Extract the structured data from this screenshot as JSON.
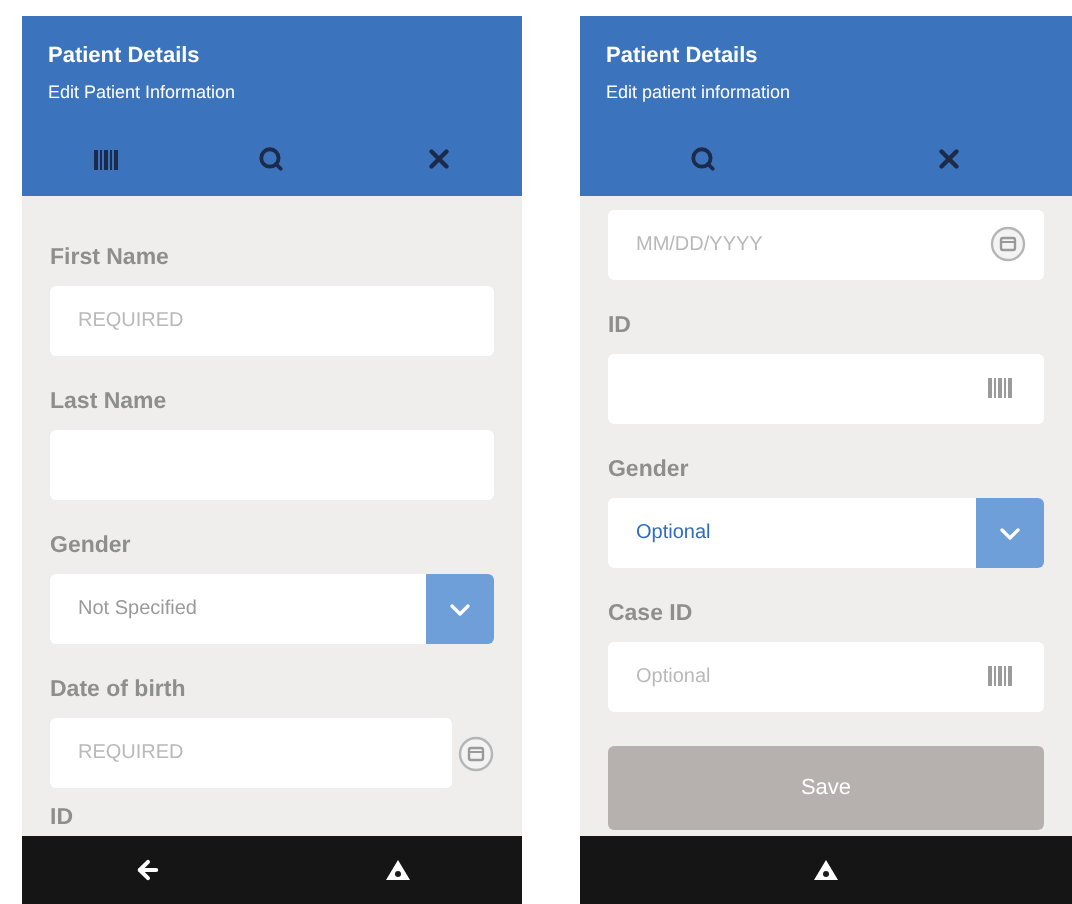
{
  "screens": [
    {
      "header": {
        "title": "Patient Details",
        "subtitle": "Edit Patient Information"
      },
      "toolbar": [
        {
          "kind": "barcode"
        },
        {
          "kind": "search"
        },
        {
          "kind": "close"
        }
      ],
      "fields": [
        {
          "kind": "text",
          "label": "First Name",
          "placeholder": "REQUIRED"
        },
        {
          "kind": "text",
          "label": "Last Name"
        },
        {
          "kind": "select",
          "label": "Gender",
          "placeholder": "Not Specified"
        },
        {
          "kind": "date_button",
          "label": "Date of birth",
          "placeholder": "REQUIRED"
        },
        {
          "kind": "label",
          "label": "ID"
        }
      ],
      "navbar": [
        {
          "kind": "back"
        },
        {
          "kind": "home"
        }
      ]
    },
    {
      "header": {
        "title": "Patient Details",
        "subtitle": "Edit patient information"
      },
      "toolbar": [
        {
          "kind": "search"
        },
        {
          "kind": "close"
        }
      ],
      "fields": [
        {
          "kind": "date",
          "placeholder": "MM/DD/YYYY"
        },
        {
          "kind": "barcode",
          "label": "ID"
        },
        {
          "kind": "select",
          "label": "Gender",
          "value": "Optional"
        },
        {
          "kind": "barcode",
          "label": "Case ID",
          "placeholder": "Optional"
        },
        {
          "kind": "button",
          "label": "Save",
          "disabled": true
        }
      ],
      "navbar": [
        {
          "kind": "home"
        }
      ]
    }
  ]
}
